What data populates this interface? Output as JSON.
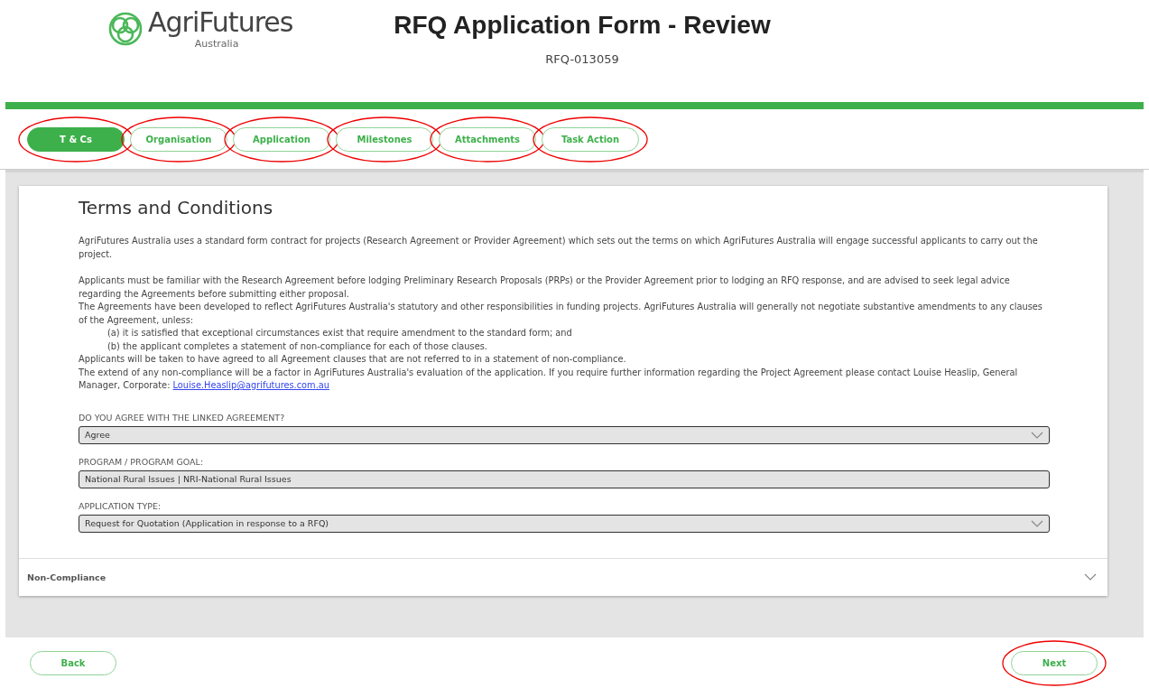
{
  "header": {
    "logo_name": "AgriFutures",
    "logo_sub": "Australia",
    "title": "RFQ Application Form - Review",
    "reference": "RFQ-013059"
  },
  "tabs": [
    {
      "label": "T & Cs",
      "selected": true,
      "annotated": true
    },
    {
      "label": "Organisation",
      "selected": false,
      "annotated": true
    },
    {
      "label": "Application",
      "selected": false,
      "annotated": true
    },
    {
      "label": "Milestones",
      "selected": false,
      "annotated": true
    },
    {
      "label": "Attachments",
      "selected": false,
      "annotated": true
    },
    {
      "label": "Task Action",
      "selected": false,
      "annotated": true
    }
  ],
  "section": {
    "title": "Terms and Conditions",
    "paragraphs": [
      {
        "kind": "text",
        "text": "AgriFutures Australia uses a standard form contract for projects (Research Agreement or Provider Agreement) which sets out the terms on which AgriFutures Australia will engage successful applicants to carry out the project."
      },
      {
        "kind": "gap"
      },
      {
        "kind": "text",
        "text": "Applicants must be familiar with the Research Agreement before lodging Preliminary Research Proposals (PRPs) or the Provider Agreement prior to lodging an RFQ response, and are advised to seek legal advice regarding the Agreements before submitting either proposal."
      },
      {
        "kind": "text",
        "text": "The Agreements have been developed to reflect AgriFutures Australia's statutory and other responsibilities in funding projects. AgriFutures Australia will generally not negotiate substantive amendments to any clauses of the Agreement, unless:"
      },
      {
        "kind": "indent",
        "text": "(a) it is satisfied that exceptional circumstances exist that require amendment to the standard form; and"
      },
      {
        "kind": "indent",
        "text": "(b) the applicant completes a statement of non-compliance for each of those clauses."
      },
      {
        "kind": "text",
        "text": "Applicants will be taken to have agreed to all Agreement clauses that are not referred to in a statement of non-compliance."
      },
      {
        "kind": "text",
        "text": "The extend of any non-compliance will be a factor in AgriFutures Australia's evaluation of the application. If you require further information regarding the Project Agreement please contact Louise Heaslip, General Manager, Corporate: ",
        "link": "Louise.Heaslip@agrifutures.com.au"
      }
    ],
    "fields": [
      {
        "label": "DO YOU AGREE WITH THE LINKED AGREEMENT?",
        "value": "Agree",
        "kind": "select"
      },
      {
        "label": "PROGRAM / PROGRAM GOAL:",
        "value": "National Rural Issues | NRI-National Rural Issues",
        "kind": "text"
      },
      {
        "label": "APPLICATION TYPE:",
        "value": "Request for Quotation (Application in response to a RFQ)",
        "kind": "select"
      }
    ]
  },
  "collapsible": {
    "title": "Non-Compliance",
    "expanded": false
  },
  "footer": {
    "back": {
      "label": "Back"
    },
    "next": {
      "label": "Next",
      "annotated": true
    }
  }
}
